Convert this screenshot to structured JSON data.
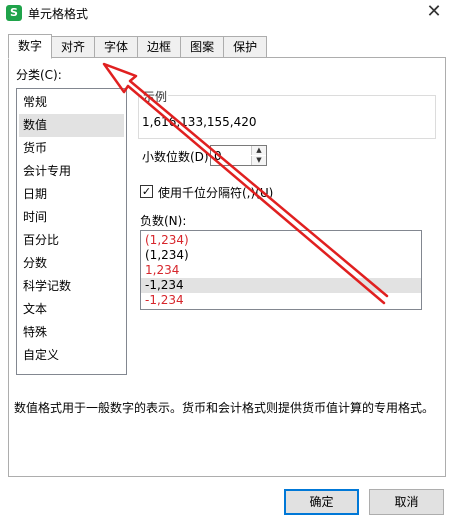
{
  "window": {
    "title": "单元格格式",
    "app_icon": "S"
  },
  "tabs": [
    {
      "label": "数字",
      "active": true
    },
    {
      "label": "对齐"
    },
    {
      "label": "字体"
    },
    {
      "label": "边框"
    },
    {
      "label": "图案"
    },
    {
      "label": "保护"
    }
  ],
  "category": {
    "label": "分类(C):",
    "items": [
      "常规",
      "数值",
      "货币",
      "会计专用",
      "日期",
      "时间",
      "百分比",
      "分数",
      "科学记数",
      "文本",
      "特殊",
      "自定义"
    ],
    "selected": "数值"
  },
  "sample": {
    "label": "示例",
    "value": "1,616,133,155,420"
  },
  "decimal": {
    "label": "小数位数(D):",
    "value": "0"
  },
  "separator": {
    "label": "使用千位分隔符(,)(U)",
    "checked": true
  },
  "negative": {
    "label": "负数(N):",
    "items": [
      {
        "text": "(1,234)",
        "color": "#d7262c"
      },
      {
        "text": "(1,234)",
        "color": "#000000"
      },
      {
        "text": "1,234",
        "color": "#d7262c"
      },
      {
        "text": "-1,234",
        "color": "#000000",
        "selected": true
      },
      {
        "text": "-1,234",
        "color": "#d7262c"
      }
    ]
  },
  "description": "数值格式用于一般数字的表示。货币和会计格式则提供货币值计算的专用格式。",
  "buttons": {
    "ok": "确定",
    "cancel": "取消"
  },
  "annotation_color": "#e02020"
}
